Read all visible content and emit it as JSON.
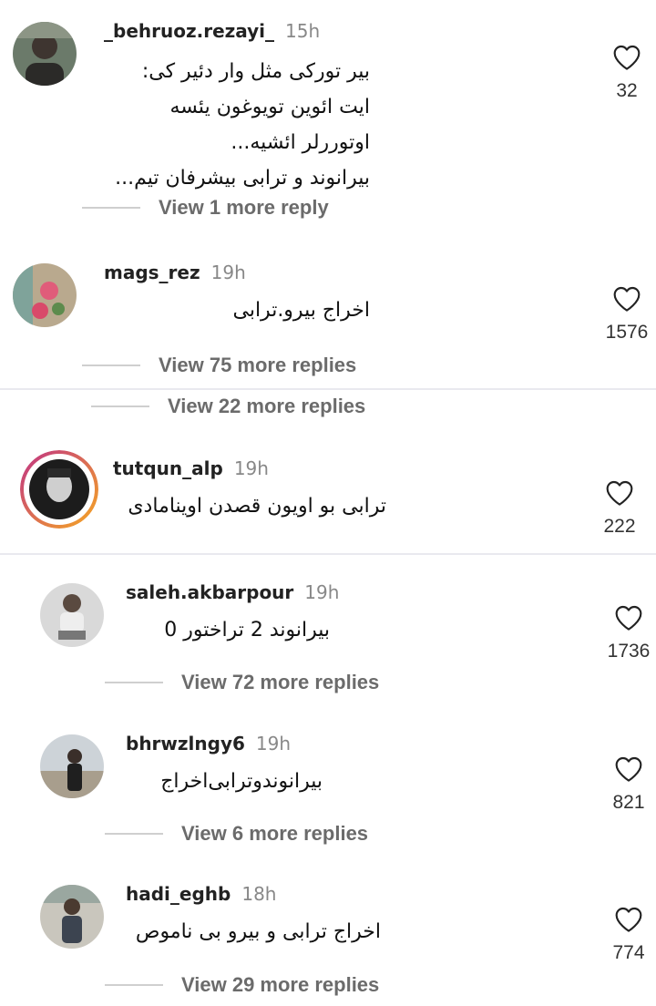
{
  "comments": [
    {
      "username": "_behruoz.rezayi_",
      "time": "15h",
      "lines": [
        "بیر تورکی مثل وار دئیر کی:",
        "ایت ائوین تویوغون یئسه",
        "اوتوررلر ائشیه...",
        "بیرانوند و ترابی بیشرفان تیم..."
      ],
      "likes": "32",
      "view_replies": "View 1 more reply"
    },
    {
      "username": "mags_rez",
      "time": "19h",
      "lines": [
        "اخراج بیرو.ترابی"
      ],
      "likes": "1576",
      "view_replies": "View 75 more replies"
    },
    {
      "view_replies": "View 22 more replies"
    },
    {
      "username": "tutqun_alp",
      "time": "19h",
      "lines": [
        "ترابی بو اویون قصدن اویناما‌دی"
      ],
      "likes": "222"
    },
    {
      "username": "saleh.akbarpour",
      "time": "19h",
      "lines": [
        "بیرانوند 2 تراختور 0"
      ],
      "likes": "1736",
      "view_replies": "View 72 more replies"
    },
    {
      "username": "bhrwzlngy6",
      "time": "19h",
      "lines": [
        "بیرانوندوترابی‌اخراج"
      ],
      "likes": "821",
      "view_replies": "View 6 more replies"
    },
    {
      "username": "hadi_eghb",
      "time": "18h",
      "lines": [
        "اخراج ترابی و بیرو بی ناموص"
      ],
      "likes": "774",
      "view_replies": "View 29 more replies"
    }
  ],
  "colors": {
    "story_ring_start": "#c13584",
    "story_ring_end": "#f5a623",
    "muted": "#6b6b6b"
  },
  "icons": [
    "heart-icon"
  ]
}
